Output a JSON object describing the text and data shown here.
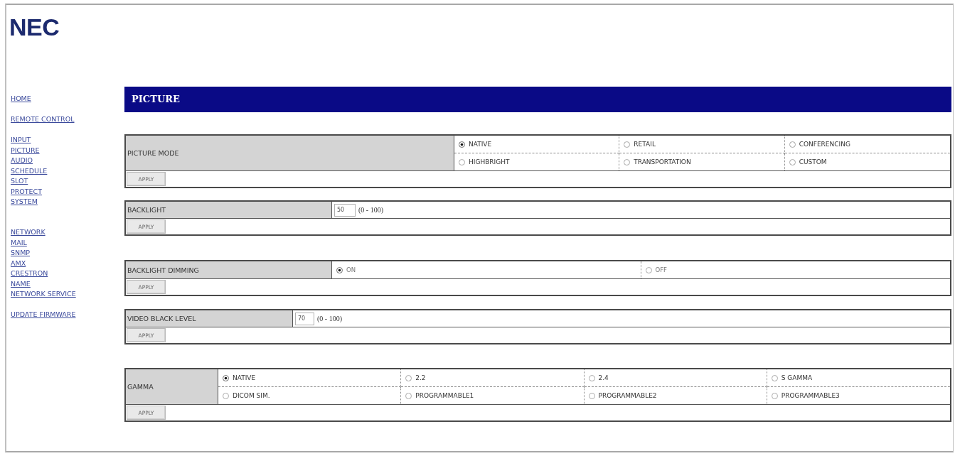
{
  "logo": {
    "text": "NEC"
  },
  "nav_groups": [
    {
      "links": [
        "HOME"
      ]
    },
    {
      "links": [
        "REMOTE CONTROL"
      ]
    },
    {
      "links": [
        "INPUT",
        "PICTURE",
        "AUDIO",
        "SCHEDULE",
        "SLOT",
        "PROTECT",
        "SYSTEM"
      ]
    },
    {
      "links": [
        "NETWORK",
        "MAIL",
        "SNMP",
        "AMX",
        "CRESTRON",
        "NAME",
        "NETWORK SERVICE"
      ]
    },
    {
      "links": [
        "UPDATE FIRMWARE"
      ]
    }
  ],
  "header": {
    "title": "PICTURE"
  },
  "sections": [
    {
      "kind": "radio",
      "label": "PICTURE MODE",
      "options": [
        {
          "label": "NATIVE",
          "selected": true
        },
        {
          "label": "RETAIL",
          "selected": false
        },
        {
          "label": "CONFERENCING",
          "selected": false
        },
        {
          "label": "HIGHBRIGHT",
          "selected": false
        },
        {
          "label": "TRANSPORTATION",
          "selected": false
        },
        {
          "label": "CUSTOM",
          "selected": false
        }
      ],
      "apply_button": "APPLY"
    },
    {
      "kind": "number",
      "label": "BACKLIGHT",
      "value": "50",
      "range": "(0 - 100)",
      "apply_button": "APPLY"
    },
    {
      "kind": "radio",
      "label": "BACKLIGHT DIMMING",
      "options": [
        {
          "label": "ON",
          "selected": true
        },
        {
          "label": "OFF",
          "selected": false
        }
      ],
      "apply_button": "APPLY"
    },
    {
      "kind": "number",
      "label": "VIDEO BLACK LEVEL",
      "value": "70",
      "range": "(0 - 100)",
      "apply_button": "APPLY"
    },
    {
      "kind": "radio",
      "label": "GAMMA",
      "options": [
        {
          "label": "NATIVE",
          "selected": true
        },
        {
          "label": "2.2",
          "selected": false
        },
        {
          "label": "2.4",
          "selected": false
        },
        {
          "label": "S GAMMA",
          "selected": false
        },
        {
          "label": "DICOM SIM.",
          "selected": false
        },
        {
          "label": "PROGRAMMABLE1",
          "selected": false
        },
        {
          "label": "PROGRAMMABLE2",
          "selected": false
        },
        {
          "label": "PROGRAMMABLE3",
          "selected": false
        }
      ],
      "apply_button": "APPLY"
    }
  ]
}
